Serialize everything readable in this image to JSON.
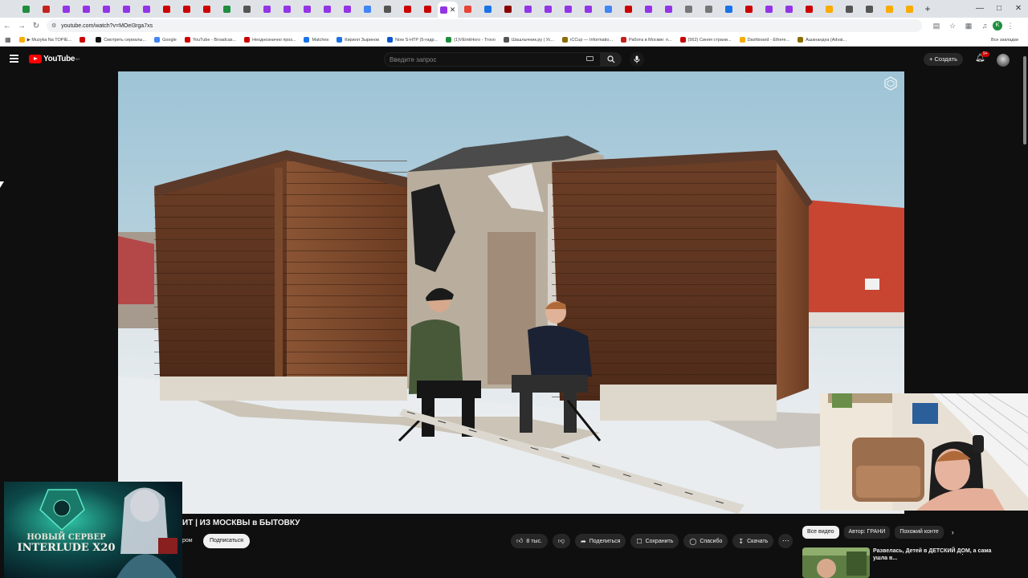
{
  "browser": {
    "url": "youtube.com/watch?v=MOeI3rga7xs",
    "tab_favicons": [
      "#1e8e3e",
      "#c5221f",
      "#9334e6",
      "#9334e6",
      "#9334e6",
      "#9334e6",
      "#9334e6",
      "#cc0000",
      "#cc0000",
      "#cc0000",
      "#1e8e3e",
      "#555",
      "#9334e6",
      "#9334e6",
      "#9334e6",
      "#9334e6",
      "#9334e6",
      "#4285f4",
      "#555",
      "#cc0000",
      "#cc0000",
      "#9334e6",
      "#ea4335",
      "#1a73e8",
      "#8b0000",
      "#9334e6",
      "#9334e6",
      "#9334e6",
      "#9334e6",
      "#4285f4",
      "#cc0000",
      "#9334e6",
      "#9334e6",
      "#777",
      "#777",
      "#1a73e8",
      "#cc0000",
      "#9334e6",
      "#9334e6",
      "#cc0000",
      "#f9ab00",
      "#555",
      "#555",
      "#f9ab00",
      "#f9ab00"
    ],
    "profile_letter": "K",
    "all_bookmarks": "Все закладки"
  },
  "bookmarks": [
    {
      "label": "▶ Muzyka Na TOPIE...",
      "color": "#f9ab00"
    },
    {
      "label": "",
      "color": "#cc0000"
    },
    {
      "label": "Смотреть сериалы...",
      "color": "#111"
    },
    {
      "label": "Google",
      "color": "#4285f4"
    },
    {
      "label": "YouTube - Broadcas...",
      "color": "#cc0000"
    },
    {
      "label": "Неоднозначно проз...",
      "color": "#cc0000"
    },
    {
      "label": "Matches",
      "color": "#1a73e8"
    },
    {
      "label": "Кирилл Зыринов",
      "color": "#1a73e8"
    },
    {
      "label": "Now S-HTP (5-гидр...",
      "color": "#0b57d0"
    },
    {
      "label": "(1)VEinkHoro - Trovo",
      "color": "#1e8e3e"
    },
    {
      "label": "Шашлычник.ру | Ус...",
      "color": "#555"
    },
    {
      "label": "iCCup — Informatio...",
      "color": "#8a6d00"
    },
    {
      "label": "Работа в Москве: п...",
      "color": "#c5221f"
    },
    {
      "label": "(562) Синяя страни...",
      "color": "#cc0000"
    },
    {
      "label": "Dashboard - Ethere...",
      "color": "#f9ab00"
    },
    {
      "label": "Ашанандха (Advai...",
      "color": "#8a6d00"
    }
  ],
  "youtube": {
    "logo_text": "YouTube",
    "region": "BY",
    "search_placeholder": "Введите запрос",
    "create_label": "Создать",
    "notifications": "9+",
    "video_title": "ИТ | ИЗ МОСКВЫ в БЫТОВКУ",
    "channel_fragment": "ром",
    "subscribe_label": "Подписаться",
    "actions": {
      "likes": "8 тыс.",
      "share": "Поделиться",
      "save": "Сохранить",
      "thanks": "Спасибо",
      "download": "Скачать"
    },
    "chips": [
      "Все видео",
      "Автор: ГРАНИ",
      "Похожий конте"
    ],
    "rec_title": "Развелась, Детей в ДЕТСКИЙ ДОМ, а сама ушла в..."
  },
  "ad": {
    "line1": "НОВЫЙ СЕРВЕР",
    "line2": "INTERLUDE X20"
  },
  "colors": {
    "yt_red": "#ff0000",
    "background": "#0f0f0f",
    "pill": "#272727"
  }
}
